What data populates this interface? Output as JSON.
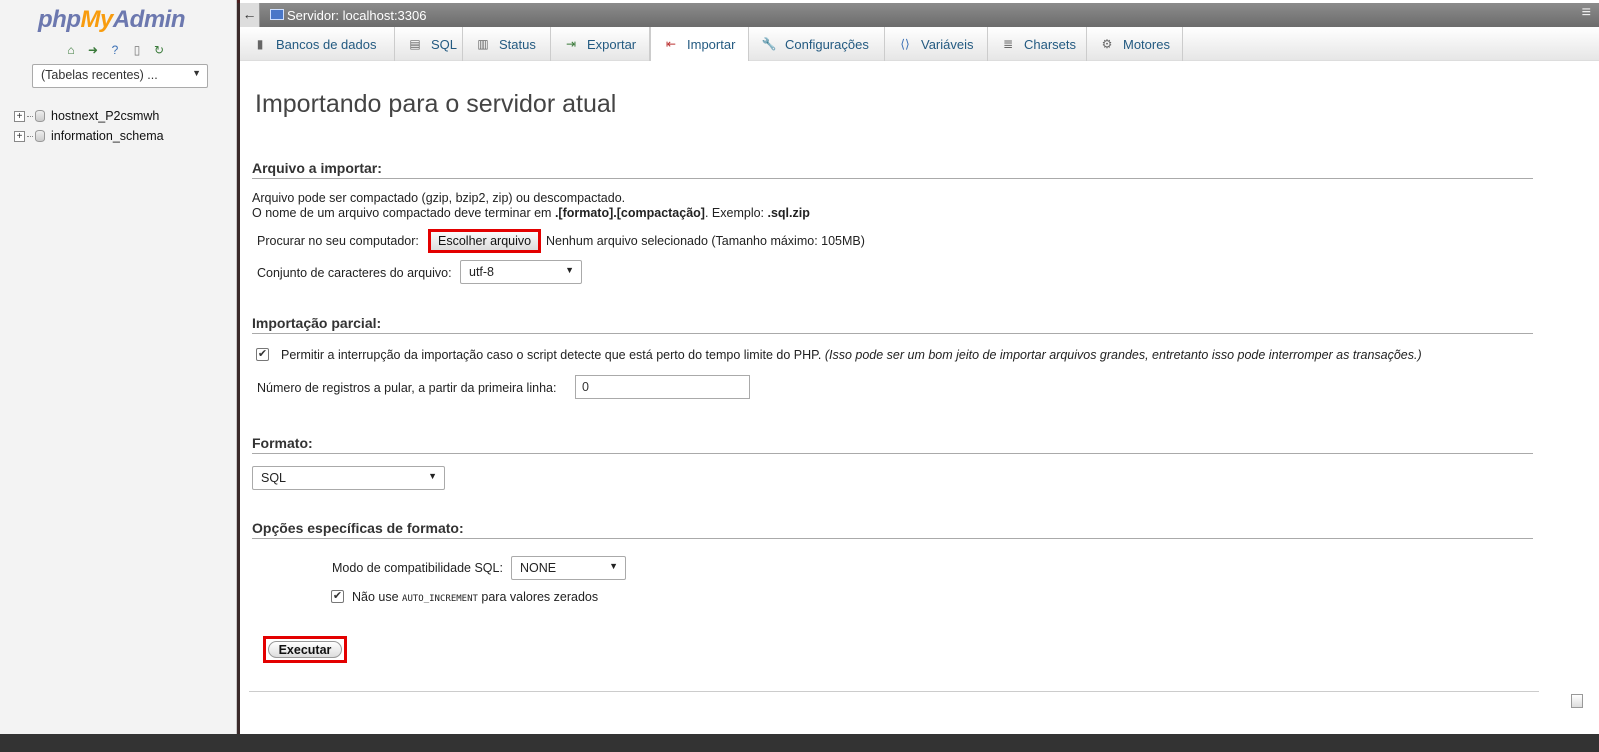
{
  "window": {
    "server_title": "Servidor: localhost:3306",
    "back_glyph": "←",
    "collapse_glyph": "≡"
  },
  "nav": {
    "logo": {
      "php": "php",
      "my": "My",
      "admin": "Admin"
    },
    "icons": [
      "home-icon",
      "logout-icon",
      "help-icon",
      "docs-icon",
      "reload-icon"
    ],
    "recent_tables": "(Tabelas recentes) ...",
    "databases": [
      {
        "name": "hostnext_P2csmwh"
      },
      {
        "name": "information_schema"
      }
    ]
  },
  "tabs": [
    {
      "label": "Bancos de dados",
      "icon": "database-icon"
    },
    {
      "label": "SQL",
      "icon": "sql-icon"
    },
    {
      "label": "Status",
      "icon": "status-icon"
    },
    {
      "label": "Exportar",
      "icon": "export-icon"
    },
    {
      "label": "Importar",
      "icon": "import-icon",
      "active": true
    },
    {
      "label": "Configurações",
      "icon": "wrench-icon"
    },
    {
      "label": "Variáveis",
      "icon": "variables-icon"
    },
    {
      "label": "Charsets",
      "icon": "charsets-icon"
    },
    {
      "label": "Motores",
      "icon": "engines-icon"
    }
  ],
  "page": {
    "title": "Importando para o servidor atual",
    "file_section": {
      "heading": "Arquivo a importar:",
      "line1": "Arquivo pode ser compactado (gzip, bzip2, zip) ou descompactado.",
      "line2_prefix": "O nome de um arquivo compactado deve terminar em ",
      "line2_bold": ".[formato].[compactação]",
      "line2_mid": ". Exemplo: ",
      "line2_example": ".sql.zip",
      "browse_label": "Procurar no seu computador:",
      "choose_button": "Escolher arquivo",
      "no_file": "Nenhum arquivo selecionado (Tamanho máximo: 105MB)",
      "charset_label": "Conjunto de caracteres do arquivo:",
      "charset_value": "utf-8"
    },
    "partial_section": {
      "heading": "Importação parcial:",
      "allow_interrupt": "Permitir a interrupção da importação caso o script detecte que está perto do tempo limite do PHP.",
      "allow_interrupt_note": "(Isso pode ser um bom jeito de importar arquivos grandes, entretanto isso pode interromper as transações.)",
      "allow_interrupt_checked": true,
      "skip_label": "Número de registros a pular, a partir da primeira linha:",
      "skip_value": "0"
    },
    "format_section": {
      "heading": "Formato:",
      "format_value": "SQL"
    },
    "format_options_section": {
      "heading": "Opções específicas de formato:",
      "compat_label": "Modo de compatibilidade SQL:",
      "compat_value": "NONE",
      "no_auto_prefix": "Não use",
      "no_auto_code": "AUTO_INCREMENT",
      "no_auto_suffix": "para valores zerados",
      "no_auto_checked": true
    },
    "execute_button": "Executar"
  }
}
